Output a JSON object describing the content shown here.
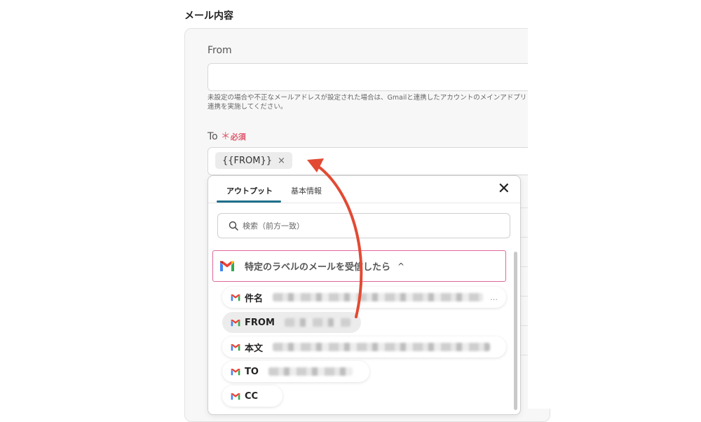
{
  "section_title": "メール内容",
  "from": {
    "label": "From",
    "value": "",
    "helper": "未設定の場合や不正なメールアドレスが設定された場合は、Gmailと連携したアカウントのメインアドプリ連携を実施してください。"
  },
  "to": {
    "label": "To",
    "required_mark": "＊",
    "required_text": "必須",
    "chip": "{{FROM}}",
    "chip_close": "×"
  },
  "dropdown": {
    "tabs": [
      "アウトプット",
      "基本情報"
    ],
    "active_tab": "アウトプット",
    "close": "✕",
    "search_placeholder": "検索（前方一致）",
    "group_title": "特定のラベルのメールを受信したら",
    "group_chevron": "^",
    "items": [
      {
        "label": "件名",
        "ellipsis": "…"
      },
      {
        "label": "FROM"
      },
      {
        "label": "本文"
      },
      {
        "label": "TO"
      },
      {
        "label": "CC"
      }
    ]
  },
  "colors": {
    "required": "#e0566b",
    "tab_underline": "#1f6f8b",
    "group_border": "#e0669b",
    "annotation_arrow": "#e24a33"
  },
  "icons": [
    "gmail-icon",
    "search-icon",
    "close-icon",
    "chevron-up-icon",
    "remove-chip-icon"
  ]
}
